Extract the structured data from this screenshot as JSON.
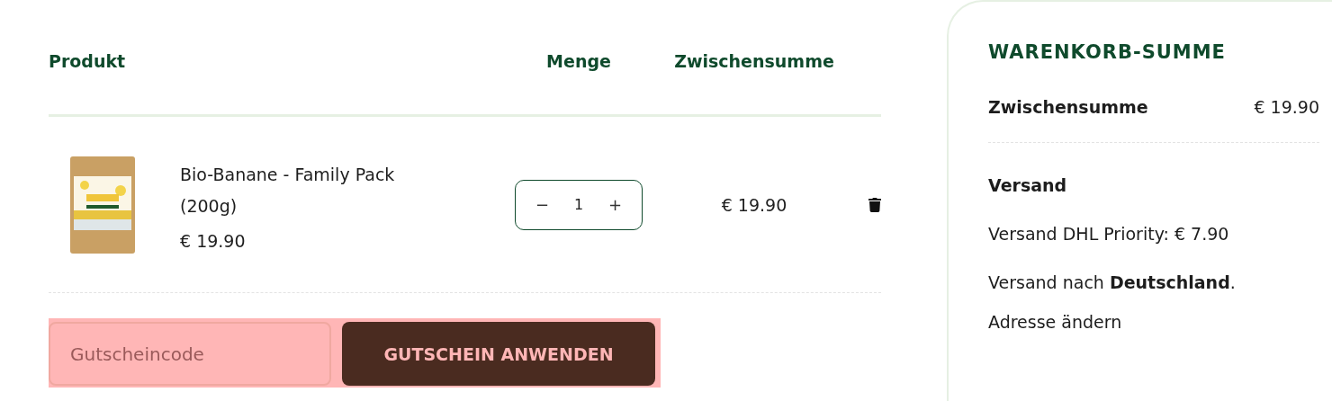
{
  "cart": {
    "columns": [
      "Produkt",
      "Menge",
      "Zwischensumme"
    ],
    "items": [
      {
        "name": "Bio-Banane - Family Pack (200g)",
        "price": "€ 19.90",
        "quantity": "1",
        "decrement": "−",
        "increment": "+",
        "subtotal": "€ 19.90"
      }
    ],
    "coupon": {
      "placeholder": "Gutscheincode",
      "button": "GUTSCHEIN ANWENDEN"
    }
  },
  "totals": {
    "title": "WARENKORB-SUMME",
    "subtotal_label": "Zwischensumme",
    "subtotal_value": "€ 19.90",
    "shipping_label": "Versand",
    "shipping_option": "Versand DHL Priority: € 7.90",
    "shipping_destination": "Versand nach **Deutschland**.",
    "change_address": "Adresse ändern"
  }
}
